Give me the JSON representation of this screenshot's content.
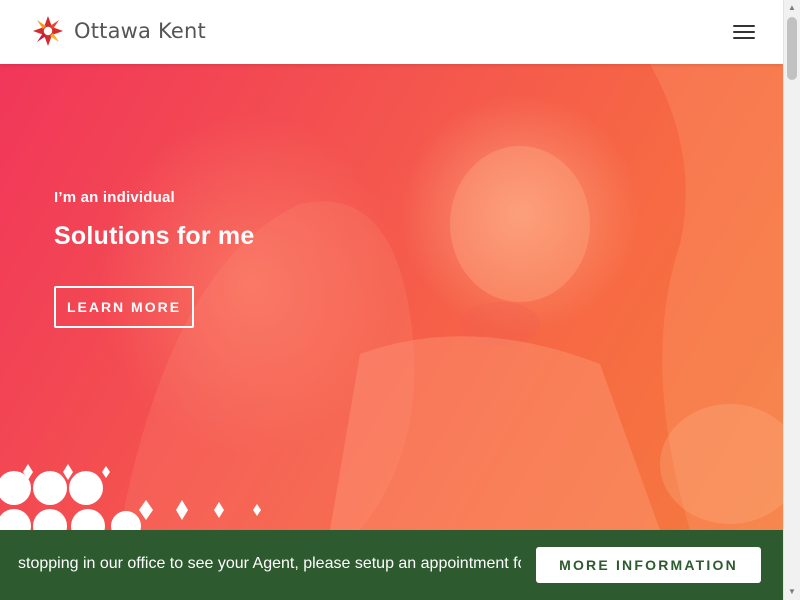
{
  "header": {
    "brand_name": "Ottawa Kent",
    "logo_icon": "starburst-logo-icon",
    "menu_icon": "hamburger-menu-icon"
  },
  "hero": {
    "eyebrow": "I’m an individual",
    "title": "Solutions for me",
    "button_label": "LEARN MORE",
    "colors": {
      "gradient_start": "#f1365a",
      "gradient_end": "#f47b3f"
    }
  },
  "notice": {
    "text": "stopping in our office to see your Agent, please setup an appointment for nor",
    "button_label": "MORE INFORMATION",
    "background_color": "#2d5a2e"
  },
  "scrollbar": {
    "up_icon": "scroll-up-arrow-icon",
    "down_icon": "scroll-down-arrow-icon"
  }
}
